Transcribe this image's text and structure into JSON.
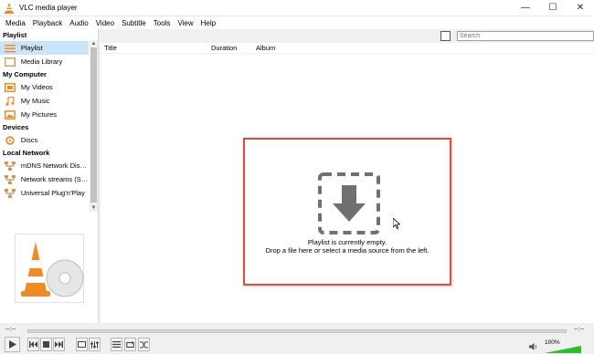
{
  "window": {
    "title": "VLC media player",
    "controls": {
      "minimize": "—",
      "maximize": "☐",
      "close": "✕"
    }
  },
  "menu": [
    "Media",
    "Playback",
    "Audio",
    "Video",
    "Subtitle",
    "Tools",
    "View",
    "Help"
  ],
  "sidebar": {
    "sections": [
      {
        "header": "Playlist",
        "items": [
          {
            "label": "Playlist",
            "icon": "playlist-icon",
            "selected": true
          },
          {
            "label": "Media Library",
            "icon": "media-library-icon"
          }
        ]
      },
      {
        "header": "My Computer",
        "items": [
          {
            "label": "My Videos",
            "icon": "videos-icon"
          },
          {
            "label": "My Music",
            "icon": "music-icon"
          },
          {
            "label": "My Pictures",
            "icon": "pictures-icon"
          }
        ]
      },
      {
        "header": "Devices",
        "items": [
          {
            "label": "Discs",
            "icon": "disc-icon"
          }
        ]
      },
      {
        "header": "Local Network",
        "items": [
          {
            "label": "mDNS Network Disco...",
            "icon": "network-icon"
          },
          {
            "label": "Network streams (SAP)",
            "icon": "network-icon"
          },
          {
            "label": "Universal Plug'n'Play",
            "icon": "network-icon"
          }
        ]
      }
    ]
  },
  "search": {
    "placeholder": "Search"
  },
  "columns": [
    "Title",
    "Duration",
    "Album"
  ],
  "drop_zone": {
    "line1": "Playlist is currently empty.",
    "line2": "Drop a file here or select a media source from the left."
  },
  "player": {
    "time_elapsed": "--:--",
    "time_total": "--:--",
    "volume_label": "100%",
    "volume_level": 1.0
  },
  "colors": {
    "accent": "#e24a3b",
    "selection": "#cce4f7",
    "vlc_orange": "#f08a24",
    "volume_green": "#2ebd2e"
  }
}
